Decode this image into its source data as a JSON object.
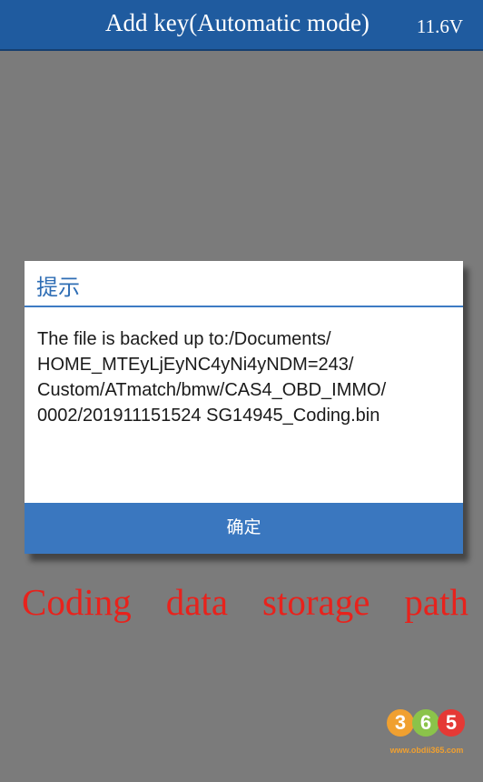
{
  "header": {
    "title": "Add key(Automatic mode)",
    "voltage": "11.6V"
  },
  "dialog": {
    "title": "提示",
    "message_lines": [
      "The file is backed up to:/Documents/",
      "HOME_MTEyLjEyNC4yNi4yNDM=243/",
      "Custom/ATmatch/bmw/CAS4_OBD_IMMO/",
      "0002/201911151524 SG14945_Coding.bin"
    ],
    "confirm_label": "确定"
  },
  "caption": {
    "words": [
      "Coding",
      "data",
      "storage",
      "path"
    ]
  },
  "watermark": {
    "digits": [
      "3",
      "6",
      "5"
    ],
    "url": "www.obdii365.com"
  },
  "colors": {
    "header_bg": "#1f5b9f",
    "dialog_accent": "#3a77bf",
    "caption_red": "#e8221c",
    "background_gray": "#7b7b7b"
  }
}
